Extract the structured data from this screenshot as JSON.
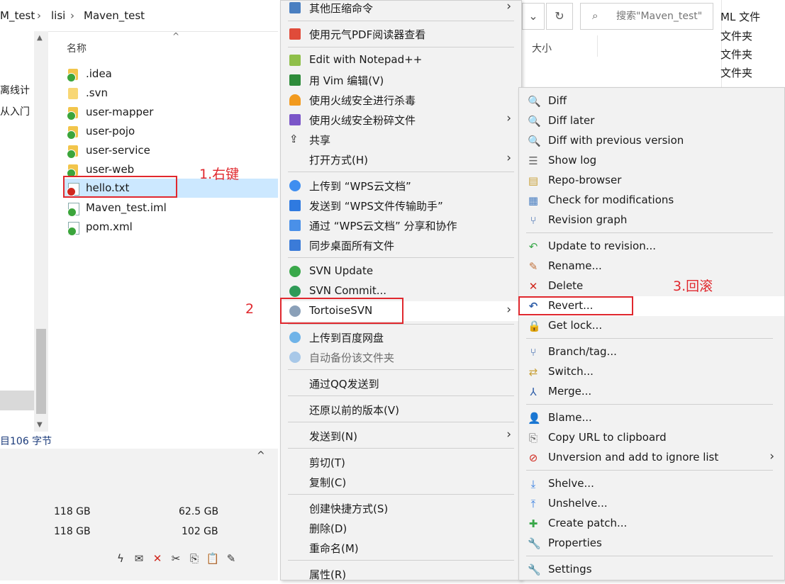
{
  "explorer": {
    "breadcrumb": [
      "M_test",
      "lisi",
      "Maven_test"
    ],
    "column_name": "名称",
    "column_size": "大小",
    "search_placeholder": "搜索\"Maven_test\"",
    "left_pane_texts": [
      "离线计",
      "从入门"
    ],
    "type_column": [
      "ML 文件",
      "文件夹",
      "文件夹",
      "文件夹"
    ],
    "files": [
      {
        "name": ".idea"
      },
      {
        "name": ".svn"
      },
      {
        "name": "user-mapper"
      },
      {
        "name": "user-pojo"
      },
      {
        "name": "user-service"
      },
      {
        "name": "user-web"
      },
      {
        "name": "hello.txt"
      },
      {
        "name": "Maven_test.iml"
      },
      {
        "name": "pom.xml"
      }
    ],
    "status_left": "目",
    "status_size": "106 字节",
    "drives": [
      {
        "total": "118 GB",
        "free": "62.5 GB"
      },
      {
        "total": "118 GB",
        "free": "102 GB"
      }
    ]
  },
  "context_menu": {
    "items": [
      {
        "label": "其他压缩命令",
        "submenu": true,
        "icon": "archive-icon"
      },
      {
        "label": "使用元气PDF阅读器查看",
        "icon": "pdf-icon"
      },
      {
        "label": "Edit with Notepad++",
        "icon": "notepad-icon"
      },
      {
        "label": "用 Vim 编辑(V)",
        "icon": "vim-icon"
      },
      {
        "label": "使用火绒安全进行杀毒",
        "icon": "shield-icon"
      },
      {
        "label": "使用火绒安全粉碎文件",
        "submenu": true,
        "icon": "shredder-icon"
      },
      {
        "label": "共享",
        "icon": "share-icon"
      },
      {
        "label": "打开方式(H)",
        "submenu": true
      },
      {
        "label": "上传到 “WPS云文档”",
        "icon": "cloud-upload-icon"
      },
      {
        "label": "发送到 “WPS文件传输助手”",
        "icon": "send-icon"
      },
      {
        "label": "通过 “WPS云文档” 分享和协作",
        "icon": "share-arrow-icon"
      },
      {
        "label": "同步桌面所有文件",
        "icon": "sync-icon"
      },
      {
        "label": "SVN Update",
        "icon": "svn-update-icon"
      },
      {
        "label": "SVN Commit...",
        "icon": "svn-commit-icon"
      },
      {
        "label": "TortoiseSVN",
        "submenu": true,
        "icon": "tortoise-icon"
      },
      {
        "label": "上传到百度网盘",
        "icon": "baidu-icon"
      },
      {
        "label": "自动备份该文件夹",
        "icon": "backup-icon"
      },
      {
        "label": "通过QQ发送到"
      },
      {
        "label": "还原以前的版本(V)"
      },
      {
        "label": "发送到(N)",
        "submenu": true
      },
      {
        "label": "剪切(T)"
      },
      {
        "label": "复制(C)"
      },
      {
        "label": "创建快捷方式(S)"
      },
      {
        "label": "删除(D)"
      },
      {
        "label": "重命名(M)"
      },
      {
        "label": "属性(R)"
      }
    ]
  },
  "svn_menu": {
    "items": [
      {
        "label": "Diff",
        "icon": "diff-icon"
      },
      {
        "label": "Diff later",
        "icon": "diff-later-icon"
      },
      {
        "label": "Diff with previous version",
        "icon": "diff-previous-icon"
      },
      {
        "label": "Show log",
        "icon": "log-icon"
      },
      {
        "label": "Repo-browser",
        "icon": "repo-browser-icon"
      },
      {
        "label": "Check for modifications",
        "icon": "check-modifications-icon"
      },
      {
        "label": "Revision graph",
        "icon": "revision-graph-icon"
      },
      {
        "label": "Update to revision...",
        "icon": "update-icon"
      },
      {
        "label": "Rename...",
        "icon": "rename-icon"
      },
      {
        "label": "Delete",
        "icon": "delete-icon"
      },
      {
        "label": "Revert...",
        "icon": "revert-icon"
      },
      {
        "label": "Get lock...",
        "icon": "lock-icon"
      },
      {
        "label": "Branch/tag...",
        "icon": "branch-icon"
      },
      {
        "label": "Switch...",
        "icon": "switch-icon"
      },
      {
        "label": "Merge...",
        "icon": "merge-icon"
      },
      {
        "label": "Blame...",
        "icon": "blame-icon"
      },
      {
        "label": "Copy URL to clipboard",
        "icon": "clipboard-icon"
      },
      {
        "label": "Unversion and add to ignore list",
        "submenu": true,
        "icon": "ignore-icon"
      },
      {
        "label": "Shelve...",
        "icon": "shelve-icon"
      },
      {
        "label": "Unshelve...",
        "icon": "unshelve-icon"
      },
      {
        "label": "Create patch...",
        "icon": "patch-icon"
      },
      {
        "label": "Properties",
        "icon": "properties-icon"
      },
      {
        "label": "Settings",
        "icon": "settings-icon"
      }
    ]
  },
  "annotations": {
    "step1": "1.右键",
    "step2": "2",
    "step3": "3.回滚"
  }
}
